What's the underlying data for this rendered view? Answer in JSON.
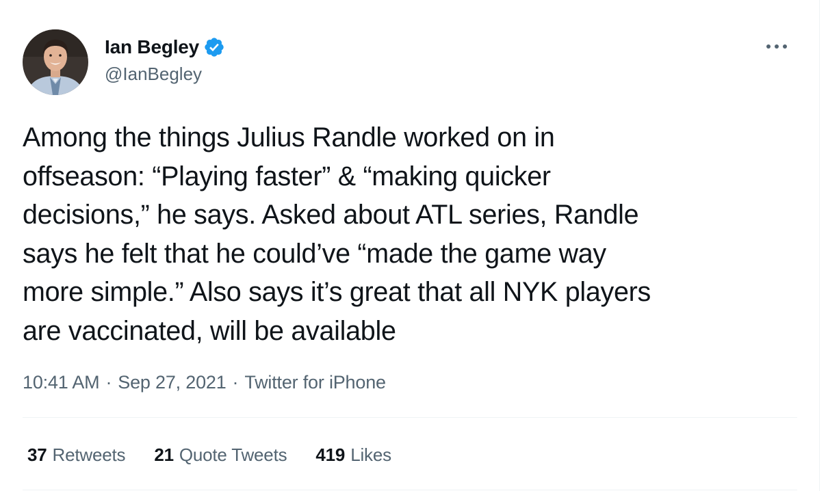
{
  "author": {
    "display_name": "Ian Begley",
    "username": "@IanBegley",
    "verified": true,
    "verified_color": "#1d9bf0"
  },
  "tweet": {
    "text": "Among the things Julius Randle worked on in\noffseason: “Playing faster” & “making quicker\ndecisions,” he says. Asked about ATL series, Randle\nsays he felt that he could’ve “made the game way\nmore simple.” Also says it’s great that all NYK players\nare vaccinated, will be available"
  },
  "meta": {
    "time": "10:41 AM",
    "separator": "·",
    "date": "Sep 27, 2021",
    "source": "Twitter for iPhone"
  },
  "stats": {
    "retweets": {
      "count": "37",
      "label": "Retweets"
    },
    "quote_tweets": {
      "count": "21",
      "label": "Quote Tweets"
    },
    "likes": {
      "count": "419",
      "label": "Likes"
    }
  },
  "icons": {
    "verified": "verified-badge-icon",
    "more": "more-horizontal-icon"
  }
}
